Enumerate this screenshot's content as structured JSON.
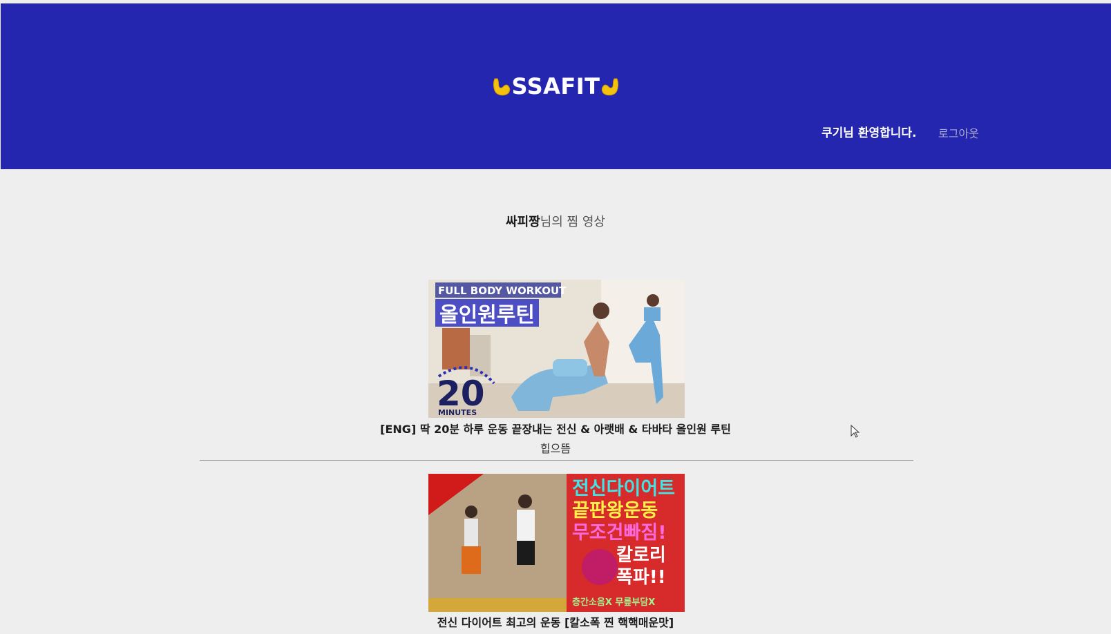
{
  "header": {
    "brand": "SSAFIT",
    "welcome": "쿠기님 환영합니다.",
    "logout_label": "로그아웃",
    "bg_color": "#2426b0"
  },
  "page": {
    "owner_name": "싸피짱",
    "title_suffix": "님의 찜 영상"
  },
  "videos": [
    {
      "title": "[ENG] 딱 20분 하루 운동 끝장내는 전신 & 아랫배 & 타바타 올인원 루틴",
      "channel": "힙으뜸",
      "thumb_text": {
        "line1": "FULL BODY WORKOUT",
        "line2": "올인원루틴",
        "number": "20",
        "unit": "MINUTES"
      }
    },
    {
      "title": "전신 다이어트 최고의 운동 [칼소폭 찐 핵핵매운맛]",
      "channel": "",
      "thumb_text": {
        "line1": "전신다이어트",
        "line2": "끝판왕운동",
        "line3": "무조건빠짐!",
        "line4": "칼로리",
        "line5": "폭파!!",
        "line6": "층간소음X 무릎부담X"
      }
    }
  ]
}
